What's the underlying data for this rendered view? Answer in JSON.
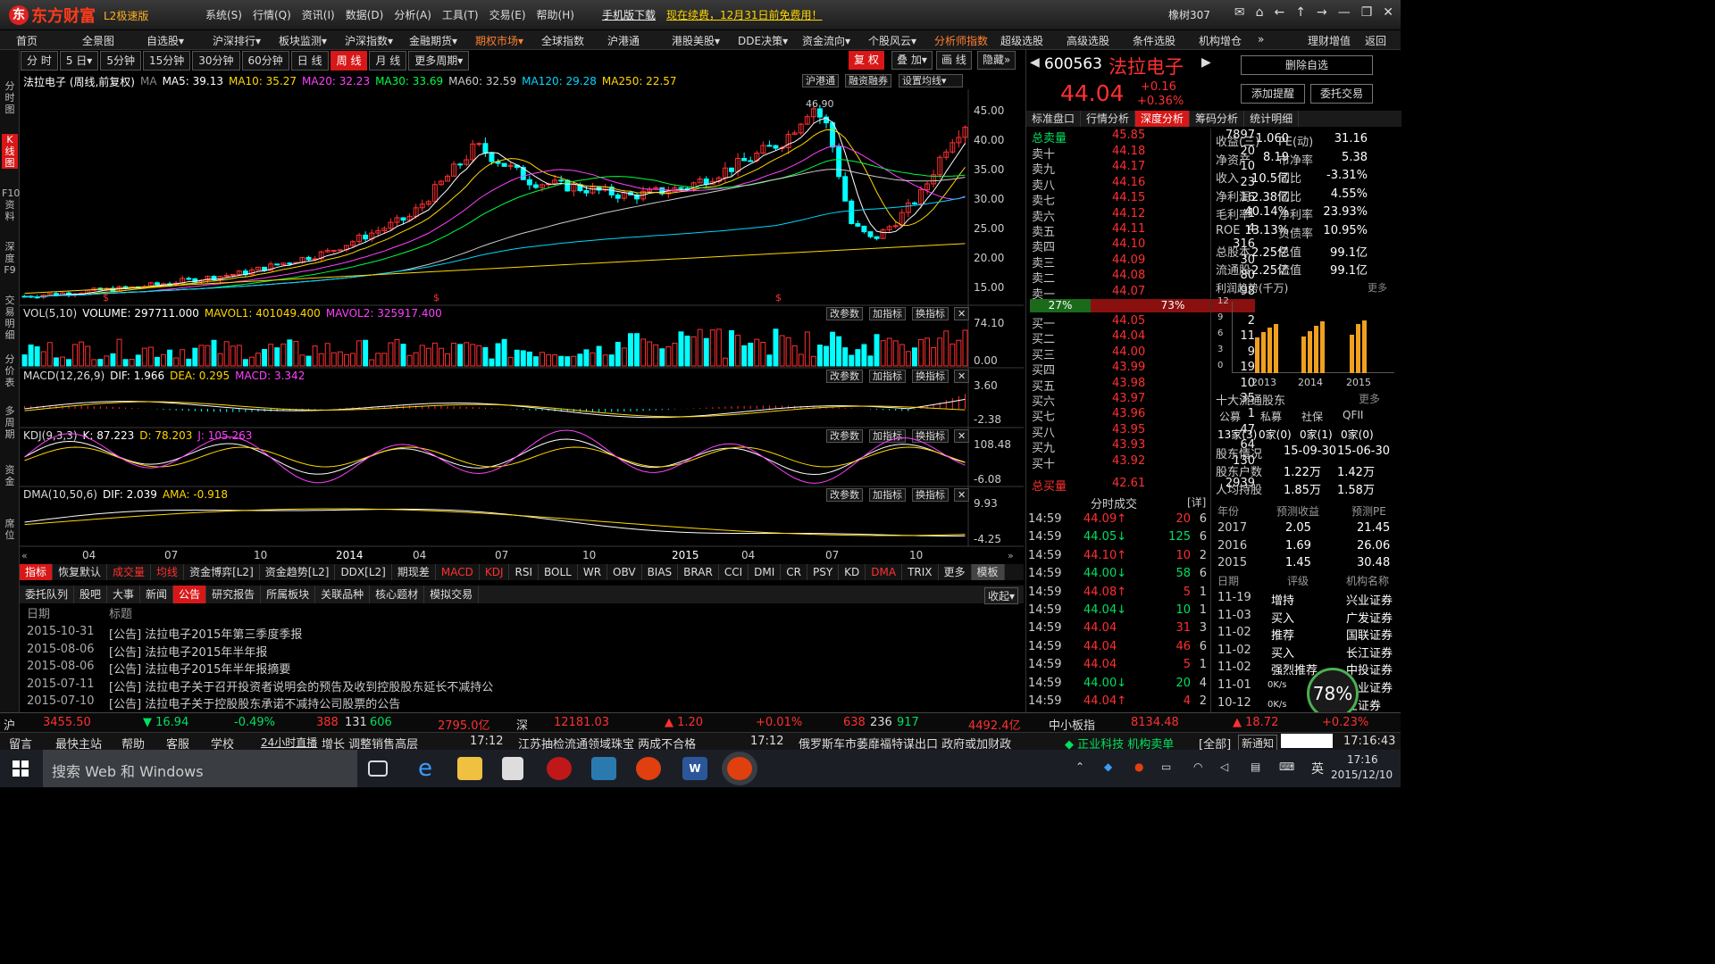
{
  "app": {
    "logo": "东方财富",
    "edition": "L2极速版"
  },
  "top_menu": [
    "系统(S)",
    "行情(Q)",
    "资讯(I)",
    "数据(D)",
    "分析(A)",
    "工具(T)",
    "交易(E)",
    "帮助(H)"
  ],
  "top_links": {
    "mobile": "手机版下载",
    "renew": "现在续费，12月31日前免费用！"
  },
  "user": "橡树307",
  "nav": [
    "首页",
    "全景图",
    "自选股▾",
    "沪深排行▾",
    "板块监测▾",
    "沪深指数▾",
    "金融期货▾",
    "期权市场▾",
    "全球指数",
    "沪港通",
    "港股美股▾",
    "DDE决策▾",
    "资金流向▾",
    "个股风云▾",
    "分析师指数",
    "超级选股",
    "高级选股",
    "条件选股",
    "机构增仓",
    "»",
    "理财增值",
    "返回"
  ],
  "side_tabs": [
    "分时图",
    "K线图",
    "F10资料",
    "深度F9",
    "交易明细",
    "分价表",
    "多周期",
    "资金",
    "席位"
  ],
  "periods": [
    "分 时",
    "5 日▾",
    "5分钟",
    "15分钟",
    "30分钟",
    "60分钟",
    "日 线",
    "周 线",
    "月 线",
    "更多周期▾"
  ],
  "active_period": "周 线",
  "chart_ctrl": [
    "复 权",
    "叠 加▾",
    "画 线",
    "隐藏»"
  ],
  "ma_bar": {
    "name": "法拉电子 (周线,前复权)",
    "ma": "MA",
    "ma5": "MA5: 39.13",
    "ma10": "MA10: 35.27",
    "ma20": "MA20: 32.23",
    "ma30": "MA30: 33.69",
    "ma60": "MA60: 32.59",
    "ma120": "MA120: 29.28",
    "ma250": "MA250: 22.57",
    "btns": [
      "沪港通",
      "融资融券",
      "设置均线▾"
    ]
  },
  "price_axis": [
    "45.00",
    "40.00",
    "35.00",
    "30.00",
    "25.00",
    "20.00",
    "15.00"
  ],
  "price_high_label": "46.90",
  "vol_bar": {
    "name": "VOL(5,10)",
    "v": "VOLUME: 297711.000",
    "m1": "MAVOL1: 401049.400",
    "m2": "MAVOL2: 325917.400",
    "axis": [
      "74.10",
      "0.00"
    ]
  },
  "macd_bar": {
    "name": "MACD(12,26,9)",
    "dif": "DIF: 1.966",
    "dea": "DEA: 0.295",
    "macd": "MACD: 3.342",
    "axis": [
      "3.60",
      "-2.38"
    ]
  },
  "kdj_bar": {
    "name": "KDJ(9,3,3)",
    "k": "K: 87.223",
    "d": "D: 78.203",
    "j": "J: 105.263",
    "axis": [
      "108.48",
      "-6.08"
    ]
  },
  "dma_bar": {
    "name": "DMA(10,50,6)",
    "dif": "DIF: 2.039",
    "ama": "AMA: -0.918",
    "axis": [
      "9.93",
      "-4.25"
    ]
  },
  "pane_btns": [
    "改参数",
    "加指标",
    "换指标"
  ],
  "x_axis": [
    "04",
    "07",
    "10",
    "2014",
    "04",
    "07",
    "10",
    "2015",
    "04",
    "07",
    "10"
  ],
  "ind_tabs": [
    "指标",
    "恢复默认",
    "成交量",
    "均线",
    "资金博弈[L2]",
    "资金趋势[L2]",
    "DDX[L2]",
    "期现差",
    "MACD",
    "KDJ",
    "RSI",
    "BOLL",
    "WR",
    "OBV",
    "BIAS",
    "BRAR",
    "CCI",
    "DMI",
    "CR",
    "PSY",
    "KD",
    "DMA",
    "TRIX",
    "更多",
    "模板"
  ],
  "info_tabs": [
    "委托队列",
    "股吧",
    "大事",
    "新闻",
    "公告",
    "研究报告",
    "所属板块",
    "关联品种",
    "核心题材",
    "模拟交易"
  ],
  "collapse": "收起▾",
  "news_header": {
    "date": "日期",
    "title": "标题"
  },
  "news": [
    {
      "date": "2015-10-31",
      "text": "[公告] 法拉电子2015年第三季度季报"
    },
    {
      "date": "2015-08-06",
      "text": "[公告] 法拉电子2015年半年报"
    },
    {
      "date": "2015-08-06",
      "text": "[公告] 法拉电子2015年半年报摘要"
    },
    {
      "date": "2015-07-11",
      "text": "[公告] 法拉电子关于召开投资者说明会的预告及收到控股股东延长不减持公"
    },
    {
      "date": "2015-07-10",
      "text": "[公告] 法拉电子关于控股股东承诺不减持公司股票的公告"
    }
  ],
  "stock": {
    "code": "600563",
    "name": "法拉电子",
    "price": "44.04",
    "change": "+0.16",
    "pct": "+0.36%"
  },
  "rp_btns": [
    "删除自选",
    "添加提醒",
    "委托交易"
  ],
  "rp_tabs": [
    "标准盘口",
    "行情分析",
    "深度分析",
    "筹码分析",
    "统计明细"
  ],
  "orderbook": {
    "sell_total": {
      "label": "总卖量",
      "price": "45.85",
      "qty": "7897"
    },
    "sells": [
      [
        "卖十",
        "44.18",
        "20"
      ],
      [
        "卖九",
        "44.17",
        "10"
      ],
      [
        "卖八",
        "44.16",
        "23"
      ],
      [
        "卖七",
        "44.15",
        "16"
      ],
      [
        "卖六",
        "44.12",
        "1"
      ],
      [
        "卖五",
        "44.11",
        "4"
      ],
      [
        "卖四",
        "44.10",
        "316"
      ],
      [
        "卖三",
        "44.09",
        "30"
      ],
      [
        "卖二",
        "44.08",
        "80"
      ],
      [
        "卖一",
        "44.07",
        "98"
      ]
    ],
    "ratio": [
      "27%",
      "73%"
    ],
    "buys": [
      [
        "买一",
        "44.05",
        "2"
      ],
      [
        "买二",
        "44.04",
        "11"
      ],
      [
        "买三",
        "44.00",
        "9"
      ],
      [
        "买四",
        "43.99",
        "19"
      ],
      [
        "买五",
        "43.98",
        "10"
      ],
      [
        "买六",
        "43.97",
        "35"
      ],
      [
        "买七",
        "43.96",
        "1"
      ],
      [
        "买八",
        "43.95",
        "47"
      ],
      [
        "买九",
        "43.93",
        "64"
      ],
      [
        "买十",
        "43.92",
        "130"
      ]
    ],
    "buy_total": {
      "label": "总买量",
      "price": "42.61",
      "qty": "2939"
    }
  },
  "fin": [
    [
      "收益(三)",
      "1.060",
      "PE(动)",
      "31.16"
    ],
    [
      "净资产",
      "8.19",
      "市净率",
      "5.38"
    ],
    [
      "收入",
      "10.5亿",
      "同比",
      "-3.31%"
    ],
    [
      "净利润",
      "2.38亿",
      "同比",
      "4.55%"
    ],
    [
      "毛利率",
      "40.14%",
      "净利率",
      "23.93%"
    ],
    [
      "ROE",
      "13.13%",
      "负债率",
      "10.95%"
    ],
    [
      "总股本",
      "2.25亿",
      "总值",
      "99.1亿"
    ],
    [
      "流通股",
      "2.25亿",
      "流值",
      "99.1亿"
    ]
  ],
  "profit_trend": {
    "title": "利润趋势(千万)",
    "more": "更多",
    "y": [
      "12",
      "9",
      "6",
      "3",
      "0"
    ],
    "years": [
      "2013",
      "2014",
      "2015"
    ],
    "values": [
      [
        6.5,
        7.5,
        8.3,
        9.0
      ],
      [
        6.6,
        7.6,
        8.6,
        9.4
      ],
      [
        6.9,
        8.9,
        9.5
      ]
    ]
  },
  "holders": {
    "title": "十大流通股东",
    "more": "更多",
    "cols": [
      "公募",
      "私募",
      "社保",
      "QFII"
    ],
    "vals": [
      "13家(3)",
      "0家(0)",
      "0家(1)",
      "0家(0)"
    ],
    "rows": [
      [
        "股东情况",
        "15-09-30",
        "15-06-30"
      ],
      [
        "股东户数",
        "1.22万",
        "1.42万"
      ],
      [
        "人均持股",
        "1.85万",
        "1.58万"
      ]
    ]
  },
  "forecast": {
    "cols": [
      "年份",
      "预测收益",
      "预测PE"
    ],
    "rows": [
      [
        "2017",
        "2.05",
        "21.45"
      ],
      [
        "2016",
        "1.69",
        "26.06"
      ],
      [
        "2015",
        "1.45",
        "30.48"
      ]
    ]
  },
  "ratings": {
    "cols": [
      "日期",
      "评级",
      "机构名称"
    ],
    "rows": [
      [
        "11-19",
        "增持",
        "兴业证券"
      ],
      [
        "11-03",
        "买入",
        "广发证券"
      ],
      [
        "11-02",
        "推荐",
        "国联证券"
      ],
      [
        "11-02",
        "买入",
        "长江证券"
      ],
      [
        "11-02",
        "强烈推荐",
        "中投证券"
      ],
      [
        "11-01",
        "",
        "华业证券"
      ],
      [
        "10-12",
        "",
        "业证券"
      ]
    ]
  },
  "ticks_title": "分时成交",
  "ticks_detail": "[详]",
  "ticks": [
    [
      "14:59",
      "44.09↑",
      "20",
      "6",
      "red"
    ],
    [
      "14:59",
      "44.05↓",
      "125",
      "6",
      "green"
    ],
    [
      "14:59",
      "44.10↑",
      "10",
      "2",
      "red"
    ],
    [
      "14:59",
      "44.00↓",
      "58",
      "6",
      "green"
    ],
    [
      "14:59",
      "44.08↑",
      "5",
      "1",
      "red"
    ],
    [
      "14:59",
      "44.04↓",
      "10",
      "1",
      "green"
    ],
    [
      "14:59",
      "44.04",
      "31",
      "3",
      "red"
    ],
    [
      "14:59",
      "44.04",
      "46",
      "6",
      "red"
    ],
    [
      "14:59",
      "44.04",
      "5",
      "1",
      "red"
    ],
    [
      "14:59",
      "44.00↓",
      "20",
      "4",
      "green"
    ],
    [
      "14:59",
      "44.04↑",
      "4",
      "2",
      "red"
    ]
  ],
  "net_widget": {
    "pct": "78%",
    "up": "0K/s",
    "down": "0K/s"
  },
  "status": {
    "sh": "沪",
    "sh_idx": "3455.50",
    "sh_chg": "▼ 16.94",
    "sh_pct": "-0.49%",
    "sh_adv": "388",
    "sh_flat": "131",
    "sh_dec": "606",
    "sh_amt": "2795.0亿",
    "sz": "深",
    "sz_idx": "12181.03",
    "sz_chg": "▲ 1.20",
    "sz_pct": "+0.01%",
    "sz_adv": "638",
    "sz_flat": "236",
    "sz_dec": "917",
    "sz_amt": "4492.4亿",
    "zx": "中小板指",
    "zx_idx": "8134.48",
    "zx_chg": "▲ 18.72",
    "zx_pct": "+0.23%"
  },
  "ticker": {
    "items": [
      "留言",
      "最快主站",
      "帮助",
      "客服",
      "学校"
    ],
    "live": "24小时直播",
    "news1": "增长  调整销售高层",
    "t1": "17:12",
    "news2": "江苏抽检流通领域珠宝  两成不合格",
    "t2": "17:12",
    "news3": "俄罗斯车市萎靡福特谋出口  政府或加财政",
    "tag": "◆ 正业科技  机构卖单",
    "all": "[全部]",
    "notify": "新通知",
    "time": "17:16:43"
  },
  "taskbar": {
    "search": "搜索 Web 和 Windows",
    "ime": "英",
    "time": "17:16",
    "date": "2015/12/10"
  },
  "colors": {
    "up": "#ff3030",
    "down": "#00ffff",
    "accent": "#d81818",
    "yellow": "#ffd700"
  }
}
